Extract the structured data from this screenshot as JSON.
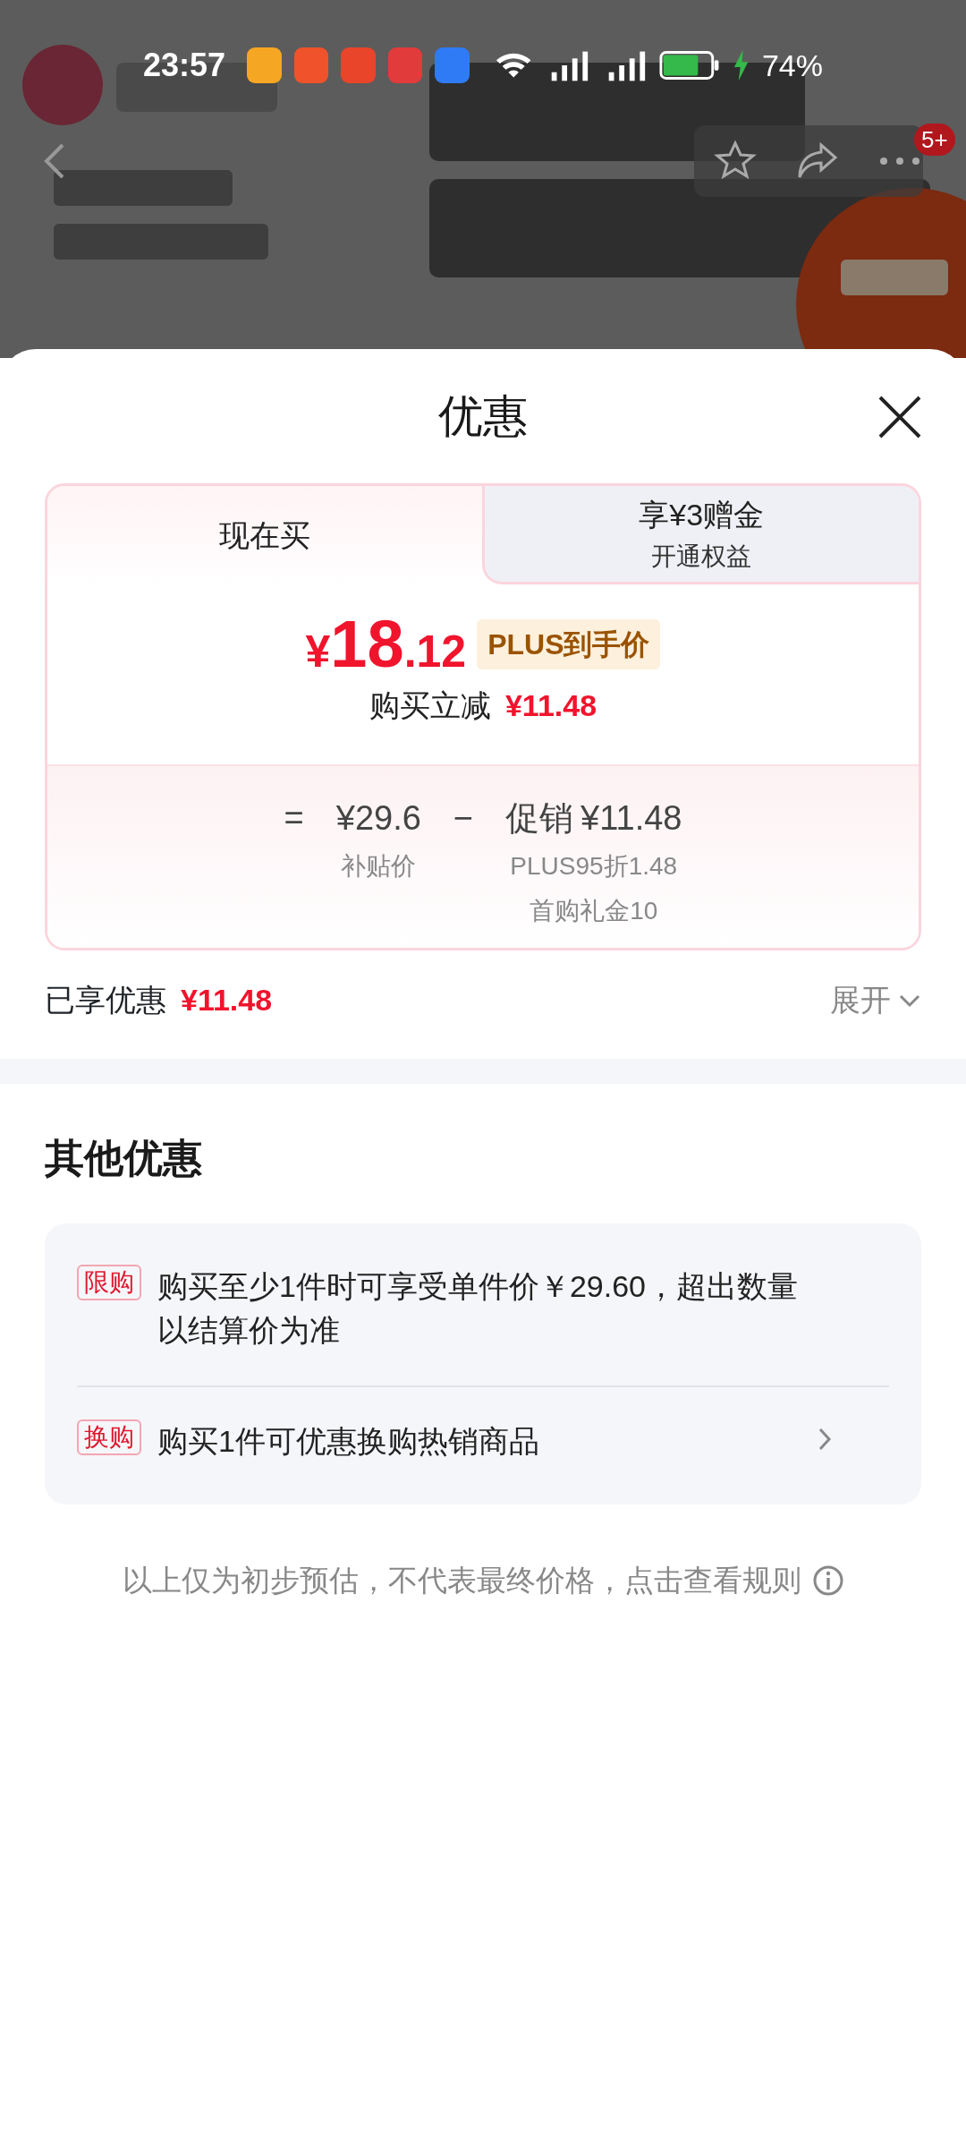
{
  "status_bar": {
    "time": "23:57",
    "battery": "74%"
  },
  "header": {
    "badge": "5+"
  },
  "sheet": {
    "title": "优惠"
  },
  "tabs": [
    {
      "label": "现在买",
      "selected": true
    },
    {
      "label": "享¥3赠金",
      "sublabel": "开通权益",
      "selected": false
    }
  ],
  "price": {
    "currency": "¥",
    "integer": "18",
    "decimal": ".12",
    "tag": "PLUS到手价",
    "reduce_label": "购买立减",
    "reduce_amount": "¥11.48"
  },
  "breakdown": {
    "equals": "=",
    "base_amount": "¥29.6",
    "base_label": "补贴价",
    "minus": "−",
    "promo_label": "促销",
    "promo_amount": "¥11.48",
    "promo_details": [
      "PLUS95折1.48",
      "首购礼金10"
    ]
  },
  "summary": {
    "label": "已享优惠",
    "amount": "¥11.48",
    "expand": "展开"
  },
  "other": {
    "title": "其他优惠",
    "items": [
      {
        "tag": "限购",
        "text": "购买至少1件时可享受单件价￥29.60，超出数量以结算价为准",
        "arrow": false
      },
      {
        "tag": "换购",
        "text": "购买1件可优惠换购热销商品",
        "arrow": true
      }
    ]
  },
  "footer": {
    "text": "以上仅为初步预估，不代表最终价格，点击查看规则"
  }
}
